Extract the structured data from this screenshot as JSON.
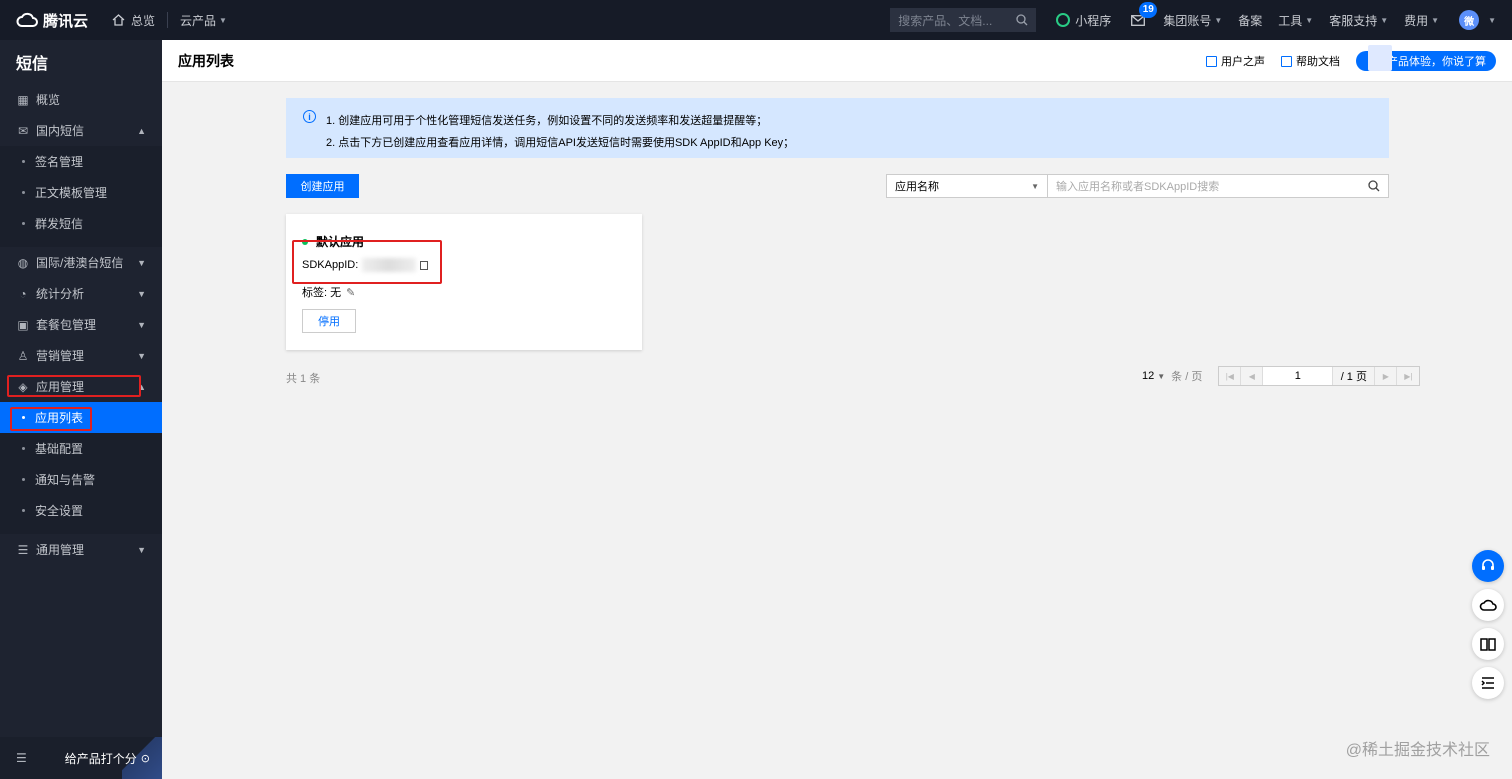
{
  "topbar": {
    "brand": "腾讯云",
    "overview": "总览",
    "products": "云产品",
    "search_placeholder": "搜索产品、文档...",
    "mini_program": "小程序",
    "mail_badge": "19",
    "account": "集团账号",
    "filing": "备案",
    "tools": "工具",
    "support": "客服支持",
    "billing": "费用",
    "avatar": "微"
  },
  "sidebar": {
    "title": "短信",
    "overview": "概览",
    "domestic": "国内短信",
    "sign_mgmt": "签名管理",
    "template_mgmt": "正文模板管理",
    "bulk_sms": "群发短信",
    "intl": "国际/港澳台短信",
    "stats": "统计分析",
    "package": "套餐包管理",
    "marketing": "营销管理",
    "app_mgmt": "应用管理",
    "app_list": "应用列表",
    "basic_config": "基础配置",
    "notify_alert": "通知与告警",
    "security": "安全设置",
    "general": "通用管理",
    "rate": "给产品打个分"
  },
  "header": {
    "title": "应用列表",
    "user_voice": "用户之声",
    "help_doc": "帮助文档",
    "survey": "产品体验，你说了算"
  },
  "notice": {
    "line1": "1. 创建应用可用于个性化管理短信发送任务，例如设置不同的发送频率和发送超量提醒等；",
    "line2": "2. 点击下方已创建应用查看应用详情，调用短信API发送短信时需要使用SDK AppID和App Key；"
  },
  "toolbar": {
    "create": "创建应用",
    "filter_select": "应用名称",
    "search_placeholder": "输入应用名称或者SDKAppID搜索"
  },
  "app": {
    "name": "默认应用",
    "sdk_label": "SDKAppID:",
    "tag_label": "标签: 无",
    "disable": "停用"
  },
  "pagination": {
    "total": "共 1 条",
    "per_page": "12",
    "per_unit": "条 / 页",
    "current": "1",
    "pages": "/ 1 页"
  },
  "watermark": "@稀土掘金技术社区"
}
